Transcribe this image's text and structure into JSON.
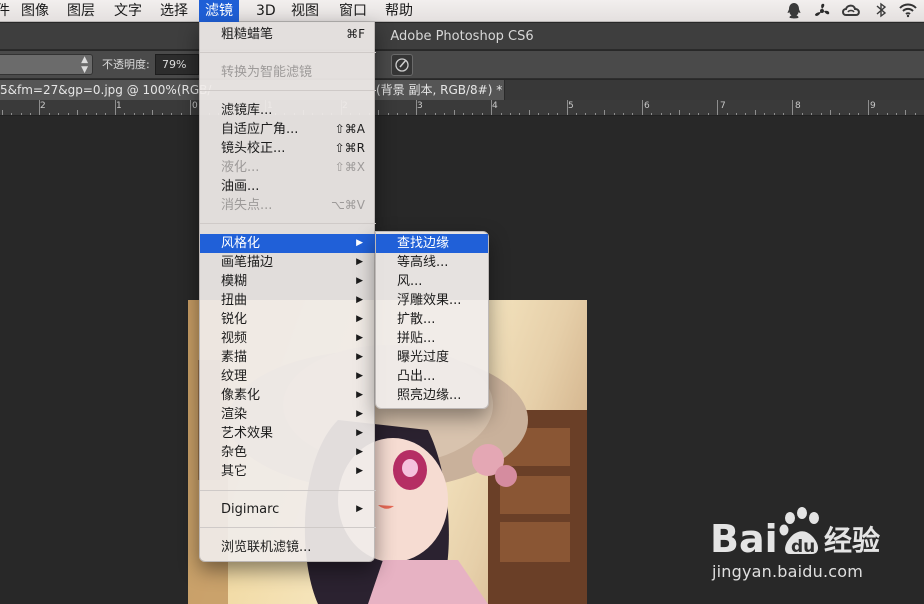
{
  "menubar": {
    "items": [
      "件",
      "图像",
      "图层",
      "文字",
      "选择",
      "滤镜",
      "3D",
      "视图",
      "窗口",
      "帮助"
    ],
    "active_index": 5,
    "tray_icons": [
      "qq-icon",
      "fan-icon",
      "creative-cloud-icon",
      "bluetooth-icon",
      "wifi-icon"
    ]
  },
  "titlebar": {
    "title": "Adobe Photoshop CS6"
  },
  "options": {
    "blend_mode": "",
    "opacity_label": "不透明度:",
    "opacity_value": "79%"
  },
  "document": {
    "tab_prefix": "5&fm=27&gp=0.jpg @ 100%(RGB/",
    "tab_suffix": "(背景 副本, RGB/8#) *"
  },
  "ruler": {
    "labels": [
      "2",
      "1",
      "0",
      "1",
      "2",
      "3",
      "4",
      "5",
      "6",
      "7",
      "8",
      "9"
    ]
  },
  "filter_menu": {
    "items": [
      {
        "label": "粗糙蜡笔",
        "shortcut": "⌘F",
        "disabled": false
      },
      {
        "label": "转换为智能滤镜",
        "shortcut": "",
        "disabled": true
      },
      {
        "label": "滤镜库...",
        "shortcut": "",
        "disabled": false
      },
      {
        "label": "自适应广角...",
        "shortcut": "⇧⌘A",
        "disabled": false
      },
      {
        "label": "镜头校正...",
        "shortcut": "⇧⌘R",
        "disabled": false
      },
      {
        "label": "液化...",
        "shortcut": "⇧⌘X",
        "disabled": true
      },
      {
        "label": "油画...",
        "shortcut": "",
        "disabled": false
      },
      {
        "label": "消失点...",
        "shortcut": "⌥⌘V",
        "disabled": true
      },
      {
        "label": "风格化",
        "submenu": true,
        "highlight": true
      },
      {
        "label": "画笔描边",
        "submenu": true
      },
      {
        "label": "模糊",
        "submenu": true
      },
      {
        "label": "扭曲",
        "submenu": true
      },
      {
        "label": "锐化",
        "submenu": true
      },
      {
        "label": "视频",
        "submenu": true
      },
      {
        "label": "素描",
        "submenu": true
      },
      {
        "label": "纹理",
        "submenu": true
      },
      {
        "label": "像素化",
        "submenu": true
      },
      {
        "label": "渲染",
        "submenu": true
      },
      {
        "label": "艺术效果",
        "submenu": true
      },
      {
        "label": "杂色",
        "submenu": true
      },
      {
        "label": "其它",
        "submenu": true
      },
      {
        "label": "Digimarc",
        "submenu": true
      },
      {
        "label": "浏览联机滤镜...",
        "shortcut": "",
        "disabled": false
      }
    ]
  },
  "stylize_submenu": {
    "items": [
      "查找边缘",
      "等高线...",
      "风...",
      "浮雕效果...",
      "扩散...",
      "拼贴...",
      "曝光过度",
      "凸出...",
      "照亮边缘..."
    ],
    "highlight_index": 0
  },
  "watermark": {
    "logo_text_a": "Bai",
    "logo_text_b": "du",
    "logo_text_c": "经验",
    "url": "jingyan.baidu.com"
  }
}
